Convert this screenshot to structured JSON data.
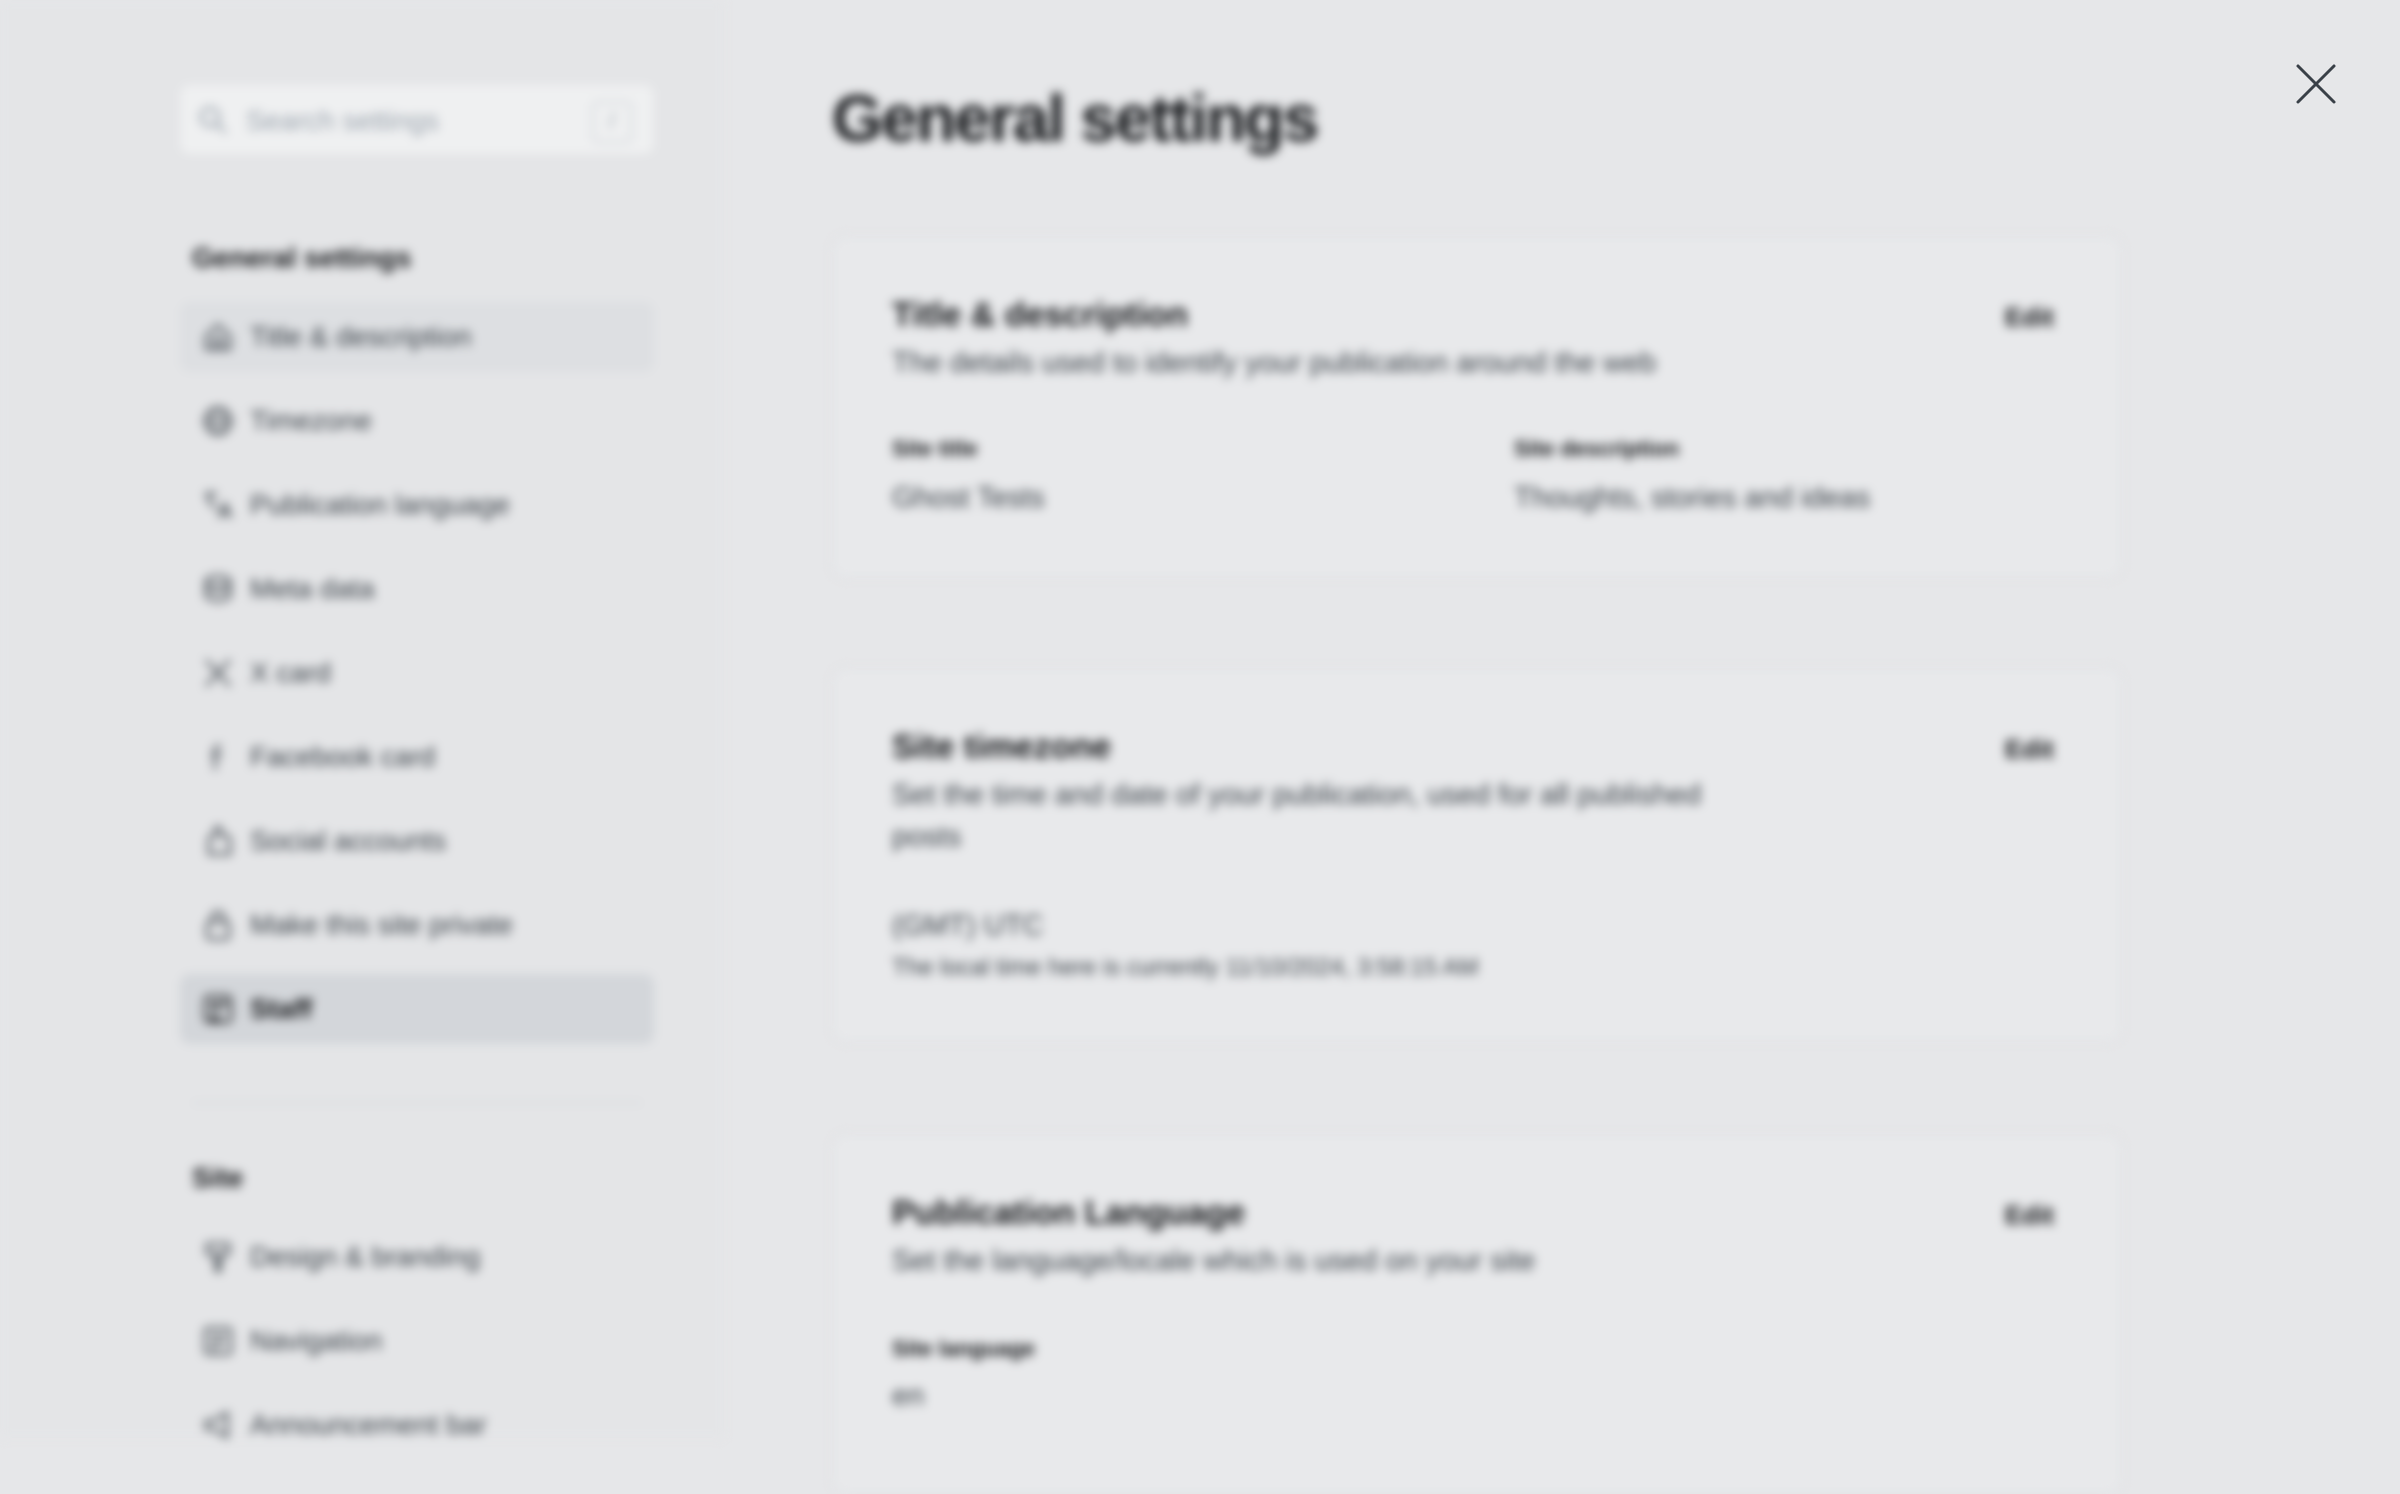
{
  "search": {
    "placeholder": "Search settings",
    "shortcut": "/"
  },
  "sidebar": {
    "general_heading": "General settings",
    "general_items": [
      {
        "label": "Title & description",
        "icon": "home-icon"
      },
      {
        "label": "Timezone",
        "icon": "globe-icon"
      },
      {
        "label": "Publication language",
        "icon": "translate-icon"
      },
      {
        "label": "Meta data",
        "icon": "database-icon"
      },
      {
        "label": "X card",
        "icon": "x-logo-icon"
      },
      {
        "label": "Facebook card",
        "icon": "facebook-icon"
      },
      {
        "label": "Social accounts",
        "icon": "hand-icon"
      },
      {
        "label": "Make this site private",
        "icon": "lock-icon"
      },
      {
        "label": "Staff",
        "icon": "staff-icon"
      }
    ],
    "site_heading": "Site",
    "site_items": [
      {
        "label": "Design & branding",
        "icon": "brush-icon"
      },
      {
        "label": "Navigation",
        "icon": "navigation-icon"
      },
      {
        "label": "Announcement bar",
        "icon": "megaphone-icon"
      }
    ]
  },
  "main": {
    "title": "General settings",
    "edit_label": "Edit",
    "title_card": {
      "title": "Title & description",
      "description": "The details used to identify your publication around the web",
      "site_title_label": "Site title",
      "site_title_value": "Ghost Tests",
      "site_description_label": "Site description",
      "site_description_value": "Thoughts, stories and ideas"
    },
    "timezone_card": {
      "title": "Site timezone",
      "description_line1": "Set the time and date of your publication, used for all published",
      "description_line2": "posts",
      "timezone_value": "(GMT) UTC",
      "local_time_note": "The local time here is currently 11/10/2024, 3:58:15 AM"
    },
    "language_card": {
      "title": "Publication Language",
      "description": "Set the language/locale which is used on your site",
      "site_language_label": "Site language",
      "site_language_value": "en"
    }
  },
  "colors": {
    "background": "#e6e7e9",
    "text": "#15171a",
    "muted": "#394047"
  }
}
